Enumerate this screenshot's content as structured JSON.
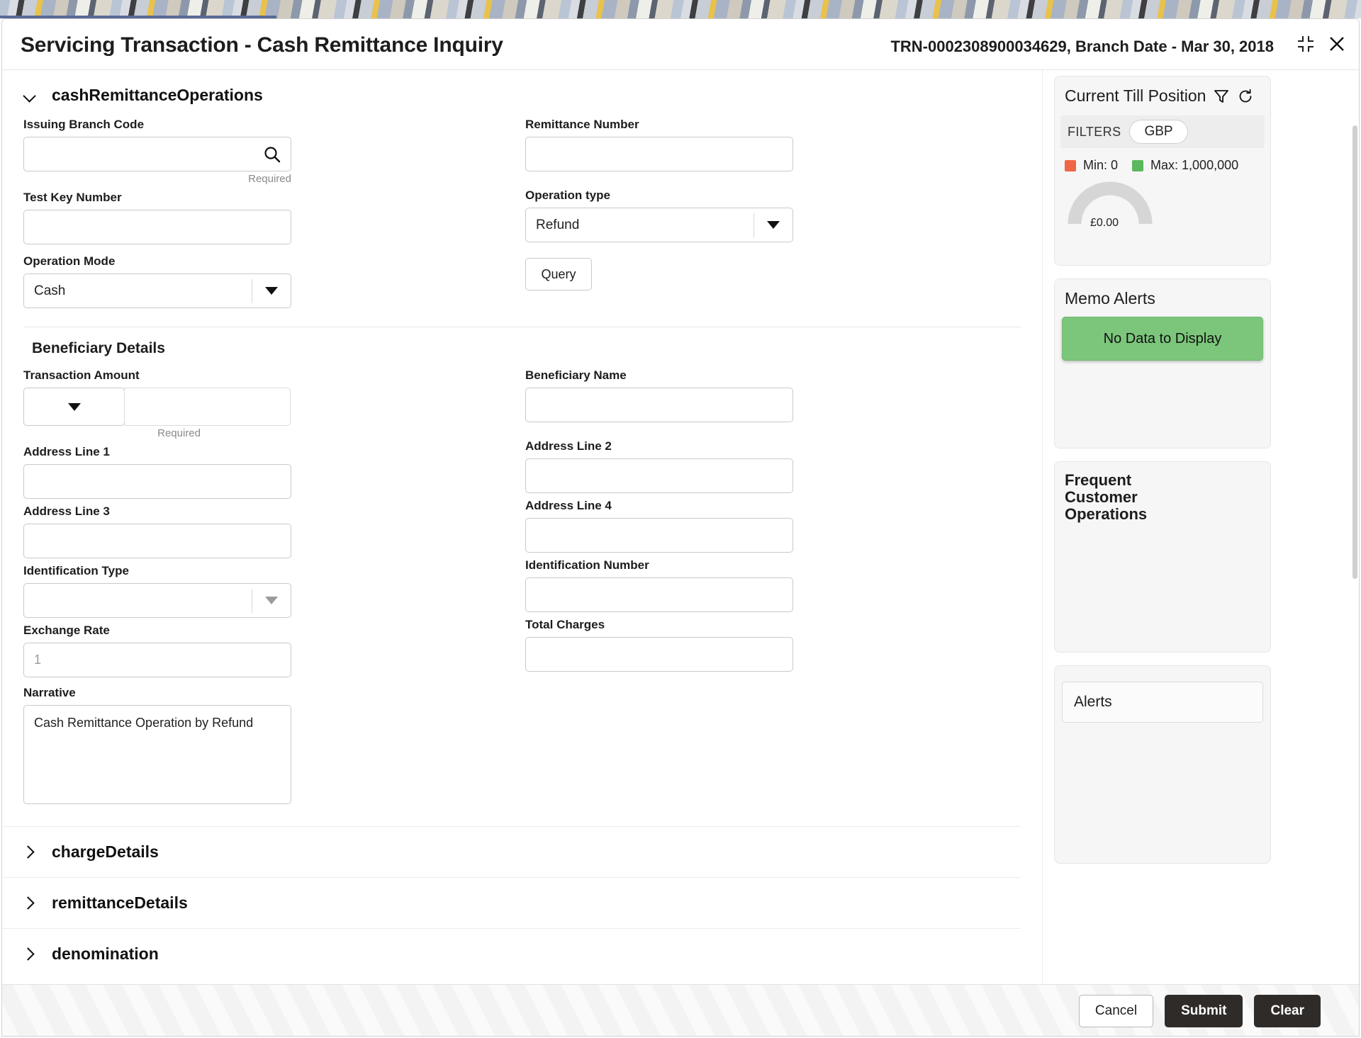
{
  "header": {
    "title": "Servicing Transaction - Cash Remittance Inquiry",
    "transaction_info": "TRN-0002308900034629, Branch Date - Mar 30, 2018",
    "collapse_icon": "collapse-icon",
    "close_icon": "close-icon"
  },
  "accordion": {
    "main_section_label": "cashRemittanceOperations",
    "subsection_label": "Beneficiary Details"
  },
  "fields": {
    "issuing_branch_code": {
      "label": "Issuing Branch Code",
      "value": "",
      "placeholder": "",
      "helper": "Required",
      "icon": "search-icon"
    },
    "test_key_number": {
      "label": "Test Key Number",
      "value": "",
      "placeholder": ""
    },
    "operation_mode": {
      "label": "Operation Mode",
      "value": "Cash",
      "options": [
        "Cash"
      ]
    },
    "remittance_number": {
      "label": "Remittance Number",
      "value": "",
      "placeholder": ""
    },
    "operation_type": {
      "label": "Operation type",
      "value": "Refund",
      "options": [
        "Refund"
      ]
    },
    "transaction_amount": {
      "label": "Transaction Amount",
      "currency": "",
      "value": "",
      "helper": "Required"
    },
    "beneficiary_name": {
      "label": "Beneficiary Name",
      "value": ""
    },
    "address_line_1": {
      "label": "Address Line 1",
      "value": ""
    },
    "address_line_2": {
      "label": "Address Line 2",
      "value": ""
    },
    "address_line_3": {
      "label": "Address Line 3",
      "value": ""
    },
    "address_line_4": {
      "label": "Address Line 4",
      "value": ""
    },
    "identification_type": {
      "label": "Identification Type",
      "value": "",
      "options": []
    },
    "identification_number": {
      "label": "Identification Number",
      "value": ""
    },
    "exchange_rate": {
      "label": "Exchange Rate",
      "value": "",
      "placeholder": "1"
    },
    "total_charges": {
      "label": "Total Charges",
      "value": ""
    },
    "narrative": {
      "label": "Narrative",
      "value": "Cash Remittance Operation by Refund"
    }
  },
  "buttons": {
    "query": "Query",
    "cancel": "Cancel",
    "submit": "Submit",
    "clear": "Clear"
  },
  "collapsed_sections": [
    {
      "label": "chargeDetails"
    },
    {
      "label": "remittanceDetails"
    },
    {
      "label": "denomination"
    }
  ],
  "sidebar": {
    "till": {
      "title": "Current Till Position",
      "filter_icon": "filter-icon",
      "refresh_icon": "refresh-icon",
      "filters_label": "FILTERS",
      "currency": "GBP",
      "min_label": "Min: 0",
      "max_label": "Max: 1,000,000",
      "min_color": "#ef6644",
      "max_color": "#5cb85c",
      "gauge_amount": "£0.00",
      "gauge_track_color": "#d6d6d6"
    },
    "memo": {
      "title": "Memo Alerts",
      "empty_message": "No Data to Display",
      "empty_bg": "#7cc67c"
    },
    "frequent_customer_operations": {
      "title": "Frequent Customer Operations"
    },
    "alerts": {
      "title": "Alerts"
    }
  }
}
